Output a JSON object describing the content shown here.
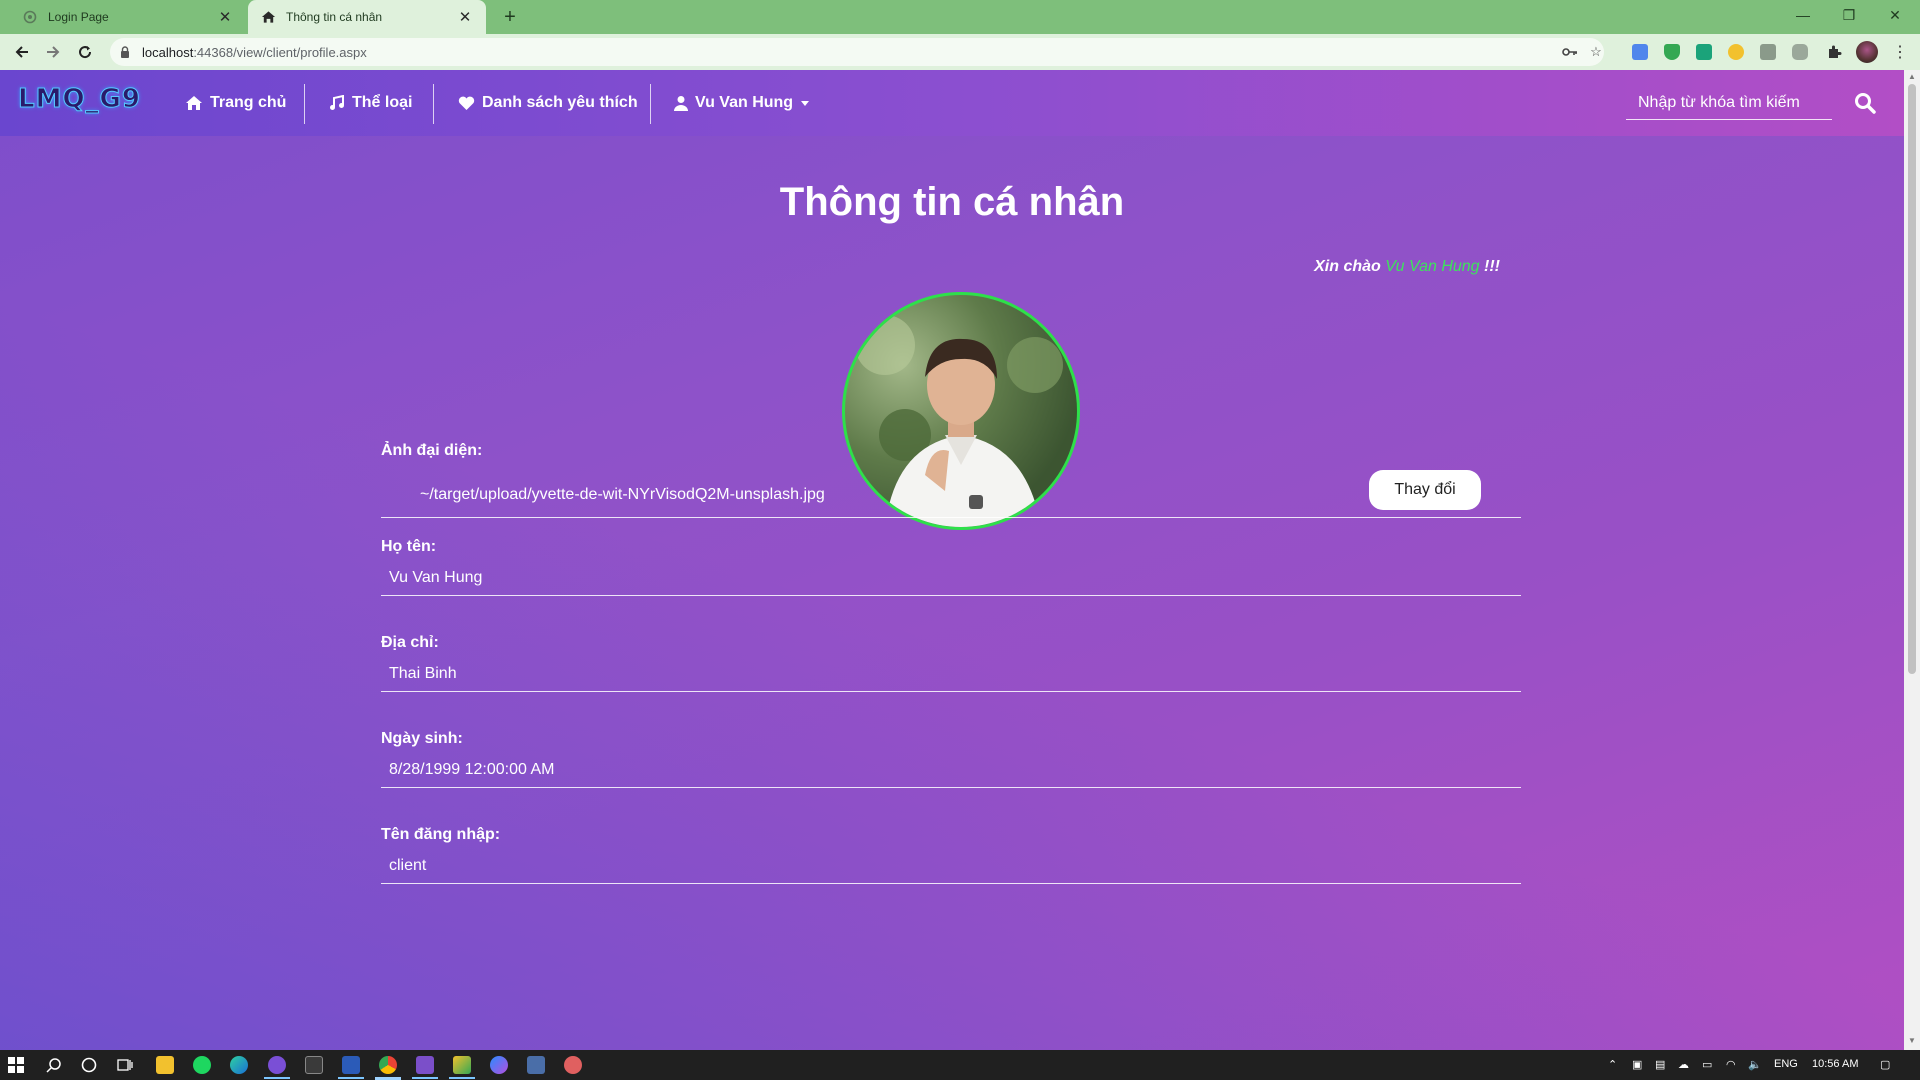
{
  "browser": {
    "tabs": [
      {
        "title": "Login Page",
        "active": false
      },
      {
        "title": "Thông tin cá nhân",
        "active": true
      }
    ],
    "url_host": "localhost",
    "url_rest": ":44368/view/client/profile.aspx"
  },
  "navbar": {
    "brand": "LMQ_G9",
    "items": [
      {
        "label": "Trang chủ",
        "icon": "home-icon"
      },
      {
        "label": "Thể loại",
        "icon": "music-icon"
      },
      {
        "label": "Danh sách yêu thích",
        "icon": "heart-icon"
      },
      {
        "label": "Vu Van Hung",
        "icon": "user-icon"
      }
    ],
    "search_placeholder": "Nhập từ khóa tìm kiếm"
  },
  "profile": {
    "title": "Thông tin cá nhân",
    "greeting_prefix": "Xin chào",
    "greeting_name": "Vu Van Hung",
    "greeting_suffix": "!!!",
    "avatar_label": "Ảnh đại diện:",
    "avatar_path": "~/target/upload/yvette-de-wit-NYrVisodQ2M-unsplash.jpg",
    "change_button": "Thay đổi",
    "fields": [
      {
        "label": "Họ tên:",
        "value": "Vu Van Hung"
      },
      {
        "label": "Địa chỉ:",
        "value": "Thai Binh"
      },
      {
        "label": "Ngày sinh:",
        "value": "8/28/1999 12:00:00 AM"
      },
      {
        "label": "Tên đăng nhập:",
        "value": "client"
      }
    ]
  },
  "taskbar": {
    "language": "ENG",
    "time": "10:56 AM"
  },
  "colors": {
    "accent_green": "#2ee04a",
    "tab_strip": "#7ebf7b",
    "gradient_start": "#6a46cf",
    "gradient_end": "#b24ec6"
  }
}
